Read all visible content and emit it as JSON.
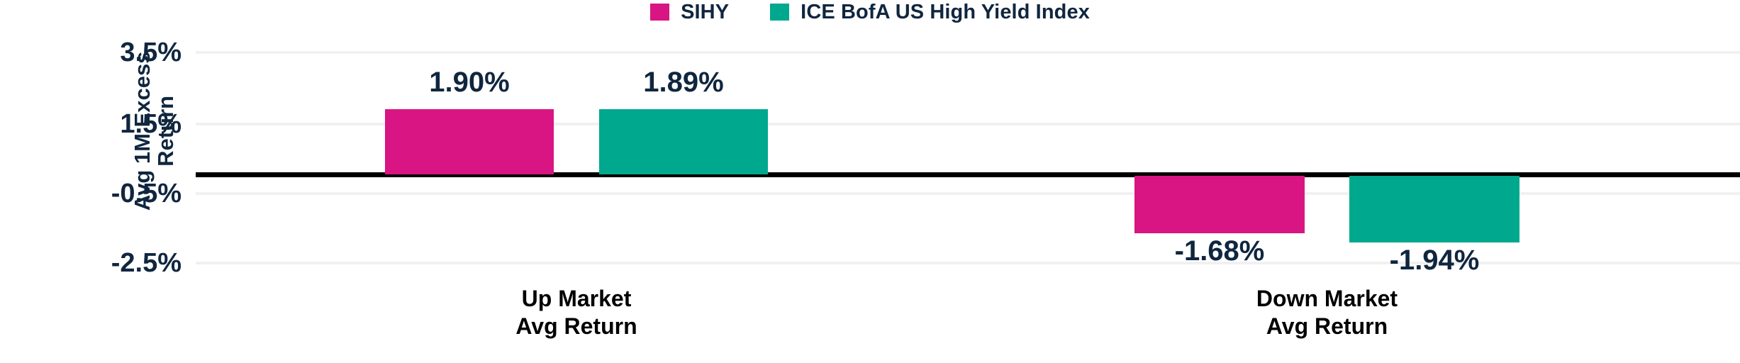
{
  "legend": {
    "items": [
      {
        "label": "SIHY",
        "color": "#D81582",
        "swatch_icon": "legend-swatch-square"
      },
      {
        "label": "ICE BofA US High Yield Index",
        "color": "#00A88E",
        "swatch_icon": "legend-swatch-square"
      }
    ]
  },
  "axis": {
    "ylabel_line1": "Avg 1M Excess",
    "ylabel_line2": "Return",
    "yticks": [
      "3.5%",
      "1.5%",
      "-0.5%",
      "-2.5%"
    ]
  },
  "categories": [
    {
      "line1": "Up Market",
      "line2": "Avg Return"
    },
    {
      "line1": "Down Market",
      "line2": "Avg Return"
    }
  ],
  "bars": [
    {
      "label": "1.90%",
      "series": "SIHY"
    },
    {
      "label": "1.89%",
      "series": "ICE BofA US High Yield Index"
    },
    {
      "label": "-1.68%",
      "series": "SIHY"
    },
    {
      "label": "-1.94%",
      "series": "ICE BofA US High Yield Index"
    }
  ],
  "chart_data": {
    "type": "bar",
    "title": "",
    "xlabel": "",
    "ylabel": "Avg 1M Excess Return",
    "categories": [
      "Up Market Avg Return",
      "Down Market Avg Return"
    ],
    "series": [
      {
        "name": "SIHY",
        "color": "#D81582",
        "values": [
          1.9,
          -1.68
        ]
      },
      {
        "name": "ICE BofA US High Yield Index",
        "color": "#00A88E",
        "values": [
          1.89,
          -1.94
        ]
      }
    ],
    "data_labels": [
      "1.90%",
      "1.89%",
      "-1.68%",
      "-1.94%"
    ],
    "ytick_labels": [
      "3.5%",
      "1.5%",
      "-0.5%",
      "-2.5%"
    ],
    "ytick_values": [
      3.5,
      1.5,
      -0.5,
      -2.5
    ],
    "ylim": [
      -3.0,
      4.0
    ],
    "units": "percent",
    "grid": true,
    "zero_line": true,
    "legend_position": "top-center",
    "orientation": "vertical"
  },
  "colors": {
    "sihy": "#D81582",
    "index": "#00A88E",
    "text_navy": "#10263F",
    "text_black": "#000000",
    "gridline": "#F1F1F1",
    "zeroline": "#000000",
    "background": "#FFFFFF"
  }
}
